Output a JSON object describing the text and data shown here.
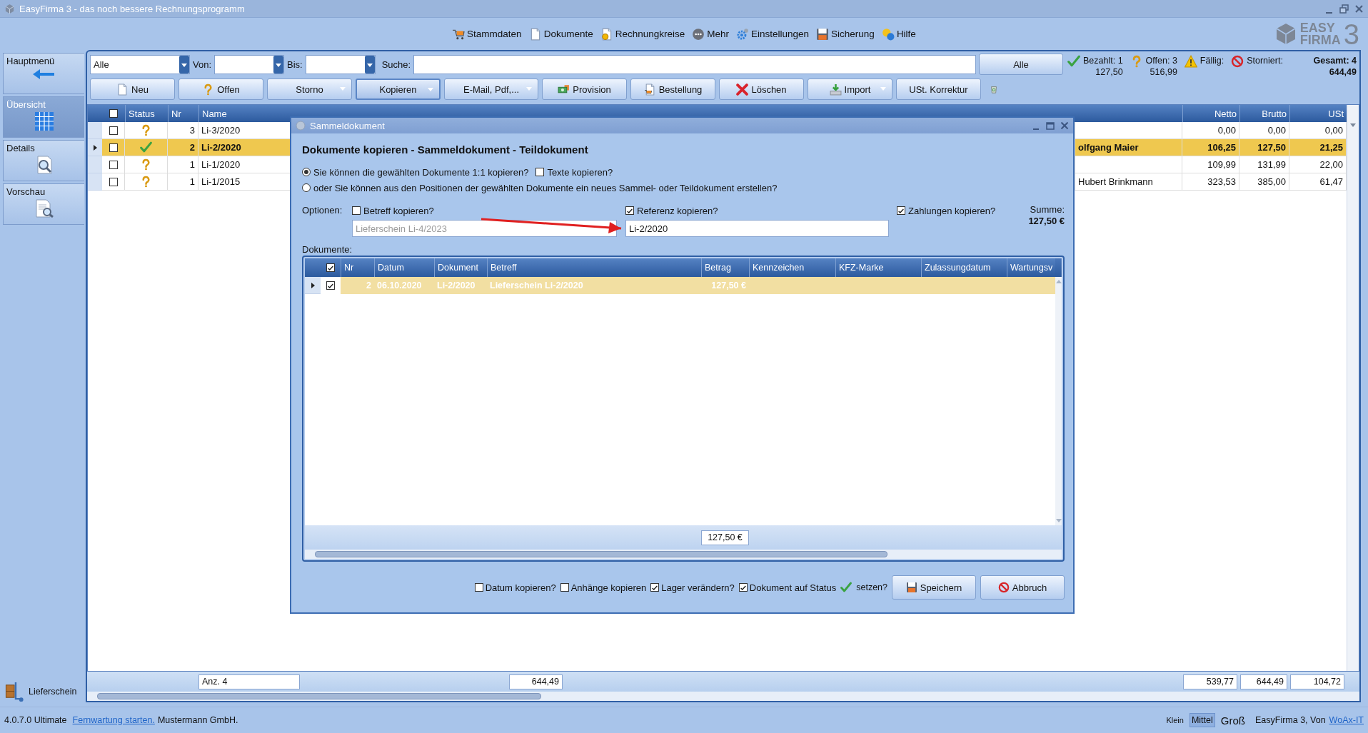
{
  "window": {
    "title": "EasyFirma 3 - das noch bessere Rechnungsprogramm"
  },
  "menu": [
    {
      "label": "Stammdaten"
    },
    {
      "label": "Dokumente"
    },
    {
      "label": "Rechnungkreise"
    },
    {
      "label": "Mehr"
    },
    {
      "label": "Einstellungen"
    },
    {
      "label": "Sicherung"
    },
    {
      "label": "Hilfe"
    }
  ],
  "logo": {
    "line_1": "EASY",
    "line_2": "FIRMA",
    "mark": "3"
  },
  "sidebar": {
    "items": [
      {
        "label": "Hauptmenü",
        "selected": false
      },
      {
        "label": "Übersicht",
        "selected": true
      },
      {
        "label": "Details",
        "selected": false
      },
      {
        "label": "Vorschau",
        "selected": false
      }
    ],
    "footer": "Lieferschein"
  },
  "filter": {
    "type_value": "Alle",
    "from_label": "Von:",
    "to_label": "Bis:",
    "search_label": "Suche:",
    "all_button": "Alle"
  },
  "summary": [
    {
      "kind": "paid",
      "label": "Bezahlt: 1",
      "amount": "127,50"
    },
    {
      "kind": "open",
      "label": "Offen: 3",
      "amount": "516,99"
    },
    {
      "kind": "due",
      "label": "Fällig:"
    },
    {
      "kind": "cancelled",
      "label": "Storniert:"
    },
    {
      "kind": "total",
      "label": "Gesamt: 4",
      "amount": "644,49"
    }
  ],
  "toolbar": [
    {
      "label": "Neu",
      "dropdown": false,
      "pressed": false
    },
    {
      "label": "Offen",
      "dropdown": false,
      "pressed": false
    },
    {
      "label": "Storno",
      "dropdown": true,
      "pressed": false
    },
    {
      "label": "Kopieren",
      "dropdown": true,
      "pressed": true
    },
    {
      "label": "E-Mail, Pdf,...",
      "dropdown": true,
      "pressed": false
    },
    {
      "label": "Provision",
      "dropdown": false,
      "pressed": false
    },
    {
      "label": "Bestellung",
      "dropdown": false,
      "pressed": false
    },
    {
      "label": "Löschen",
      "dropdown": false,
      "pressed": false
    },
    {
      "label": "Import",
      "dropdown": true,
      "pressed": false
    },
    {
      "label": "USt. Korrektur",
      "dropdown": false,
      "pressed": false
    }
  ],
  "table": {
    "header_checked": false,
    "columns": [
      "Status",
      "Nr",
      "Name",
      "Netto",
      "Brutto",
      "USt"
    ],
    "rows": [
      {
        "selected": false,
        "checked": false,
        "kind": "open",
        "nr": "3",
        "name": "Li-3/2020",
        "netto": "0,00",
        "brutto": "0,00",
        "ust": "0,00"
      },
      {
        "selected": true,
        "checked": false,
        "kind": "paid",
        "nr": "2",
        "name": "Li-2/2020",
        "column_5": "olfgang Maier",
        "netto": "106,25",
        "brutto": "127,50",
        "ust": "21,25"
      },
      {
        "selected": false,
        "checked": false,
        "kind": "open",
        "nr": "1",
        "name": "Li-1/2020",
        "netto": "109,99",
        "brutto": "131,99",
        "ust": "22,00"
      },
      {
        "selected": false,
        "checked": false,
        "kind": "open",
        "nr": "1",
        "name": "Li-1/2015",
        "column_5": "Hubert Brinkmann",
        "netto": "323,53",
        "brutto": "385,00",
        "ust": "61,47"
      }
    ],
    "totals": {
      "count": "Anz. 4",
      "amount": "644,49",
      "netto": "539,77",
      "brutto": "644,49",
      "ust": "104,72"
    }
  },
  "dialog": {
    "title": "Sammeldokument",
    "heading": "Dokumente kopieren - Sammeldokument - Teildokument",
    "copy_modes": [
      {
        "label": "Sie können die gewählten Dokumente 1:1 kopieren?",
        "selected": true
      },
      {
        "label": "oder Sie können aus den Positionen der gewählten Dokumente ein neues Sammel- oder Teildokument erstellen?",
        "selected": false
      }
    ],
    "copy_texts": {
      "label": "Texte kopieren?",
      "checked": false
    },
    "options_label": "Optionen:",
    "options": [
      {
        "label": "Betreff kopieren?",
        "checked": false,
        "value": "Lieferschein Li-4/2023",
        "disabled": true
      },
      {
        "label": "Referenz kopieren?",
        "checked": true,
        "value": "Li-2/2020",
        "disabled": false
      },
      {
        "label": "Zahlungen kopieren?",
        "checked": true
      }
    ],
    "sum_label": "Summe:",
    "sum": "127,50 €",
    "documents_label": "Dokumente:",
    "grid": {
      "header_checked": true,
      "columns": [
        "Nr",
        "Datum",
        "Dokument",
        "Betreff",
        "Betrag",
        "Kennzeichen",
        "KFZ-Marke",
        "Zulassungdatum",
        "Wartungsv"
      ],
      "rows": [
        {
          "selected": true,
          "checked": true,
          "cells": [
            "2",
            "06.10.2020",
            "Li-2/2020",
            "Lieferschein Li-2/2020",
            "127,50 €"
          ]
        }
      ],
      "total": "127,50 €"
    },
    "footer_options": [
      {
        "label": "Datum kopieren?",
        "checked": false
      },
      {
        "label": "Anhänge kopieren",
        "checked": false
      },
      {
        "label": "Lager verändern?",
        "checked": true
      },
      {
        "label": "Dokument auf Status",
        "checked": true
      }
    ],
    "status_suffix": "setzen?",
    "buttons": [
      {
        "label": "Speichern",
        "kind": "save"
      },
      {
        "label": "Abbruch",
        "kind": "cancel"
      }
    ]
  },
  "status_bar": {
    "version": "4.0.7.0 Ultimate",
    "remote_link": "Fernwartung starten.",
    "company": "Mustermann GmbH.",
    "sizes": [
      {
        "label": "Klein",
        "selected": false
      },
      {
        "label": "Mittel",
        "selected": true
      },
      {
        "label": "Groß",
        "selected": false
      }
    ],
    "credit": "EasyFirma 3, Von",
    "vendor_link": "WoAx-IT"
  }
}
